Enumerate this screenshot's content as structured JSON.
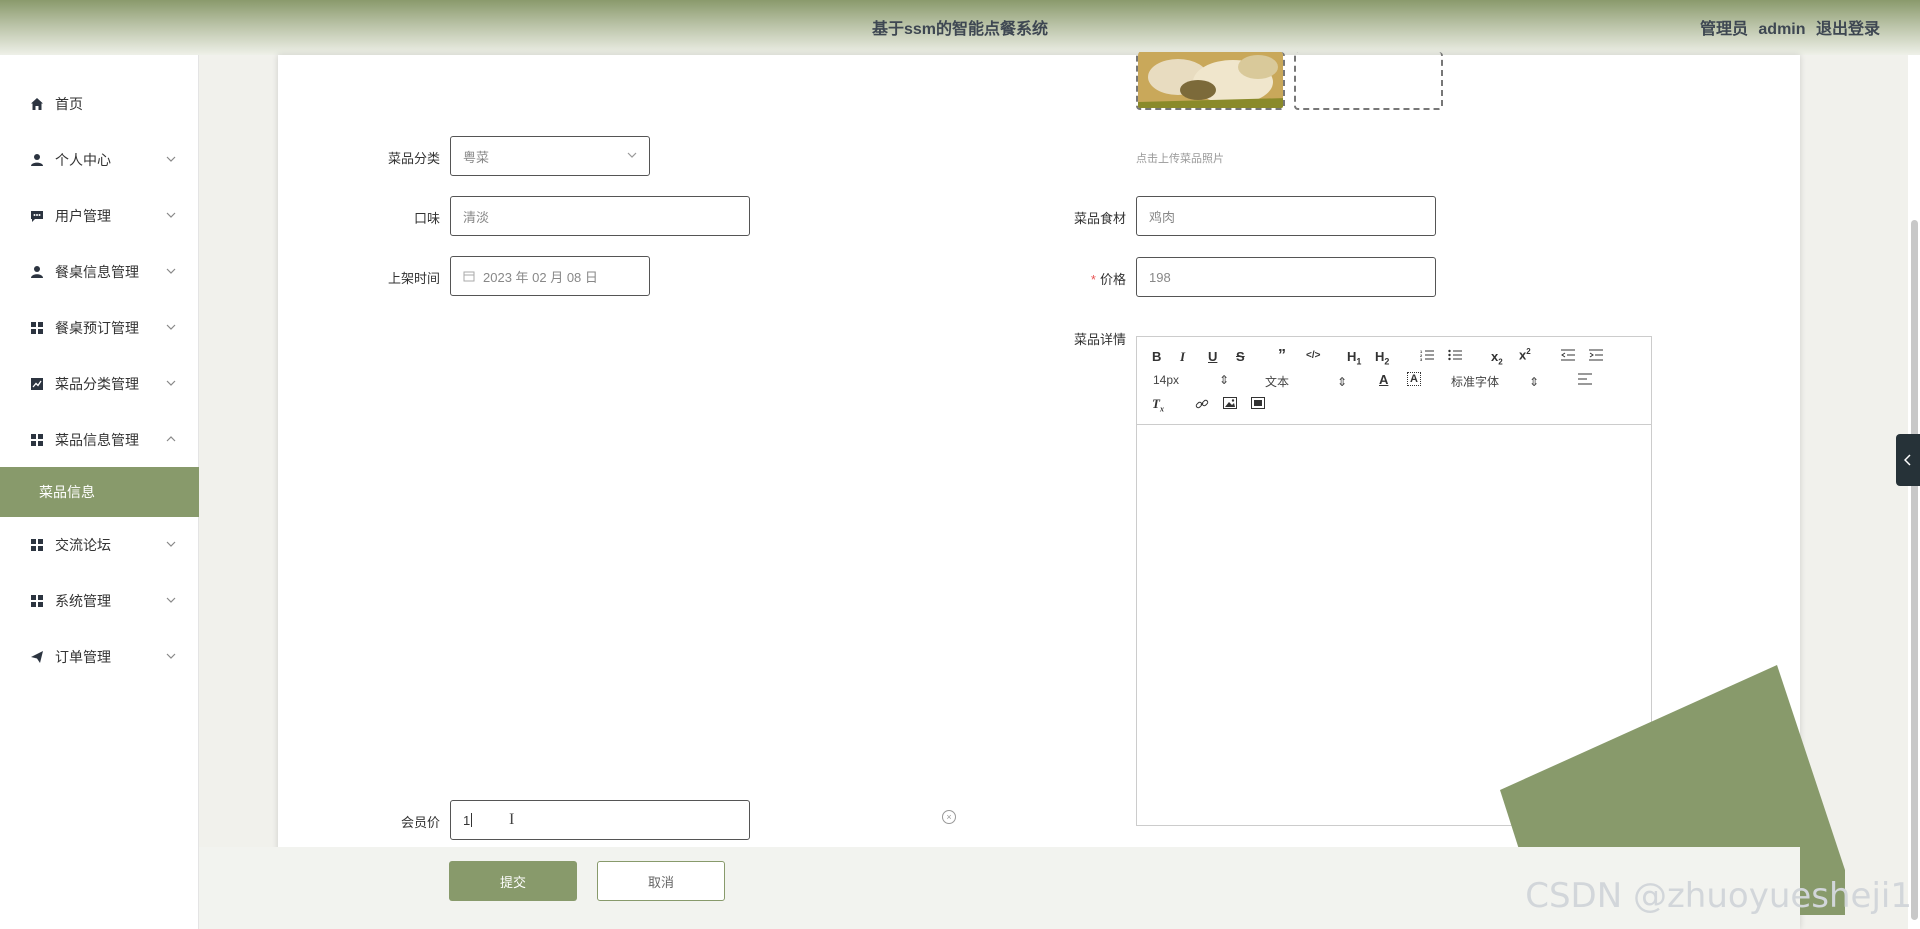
{
  "header": {
    "title": "基于ssm的智能点餐系统",
    "role": "管理员",
    "username": "admin",
    "logout": "退出登录"
  },
  "sidebar": {
    "items": [
      {
        "label": "首页",
        "icon": "home-icon"
      },
      {
        "label": "个人中心",
        "icon": "user-icon"
      },
      {
        "label": "用户管理",
        "icon": "chat-icon"
      },
      {
        "label": "餐桌信息管理",
        "icon": "person-icon"
      },
      {
        "label": "餐桌预订管理",
        "icon": "grid-icon"
      },
      {
        "label": "菜品分类管理",
        "icon": "chart-icon"
      },
      {
        "label": "菜品信息管理",
        "icon": "grid-icon"
      },
      {
        "label": "交流论坛",
        "icon": "grid-icon"
      },
      {
        "label": "系统管理",
        "icon": "grid-icon"
      },
      {
        "label": "订单管理",
        "icon": "send-icon"
      }
    ],
    "active_sub": "菜品信息"
  },
  "form": {
    "category_label": "菜品分类",
    "category_value": "粤菜",
    "taste_label": "口味",
    "taste_value": "清淡",
    "date_label": "上架时间",
    "date_value": "2023 年 02 月 08 日",
    "upload_hint": "点击上传菜品照片",
    "ingredient_label": "菜品食材",
    "ingredient_value": "鸡肉",
    "price_label": "价格",
    "price_required": "*",
    "price_value": "198",
    "detail_label": "菜品详情",
    "member_price_label": "会员价",
    "member_price_value": "1"
  },
  "editor": {
    "font_size": "14px",
    "text_type": "文本",
    "font_family": "标准字体"
  },
  "buttons": {
    "submit": "提交",
    "cancel": "取消"
  },
  "watermark": "CSDN @zhuoyuesheji1",
  "colors": {
    "accent": "#889a6b",
    "header_dark": "#3e4752"
  }
}
